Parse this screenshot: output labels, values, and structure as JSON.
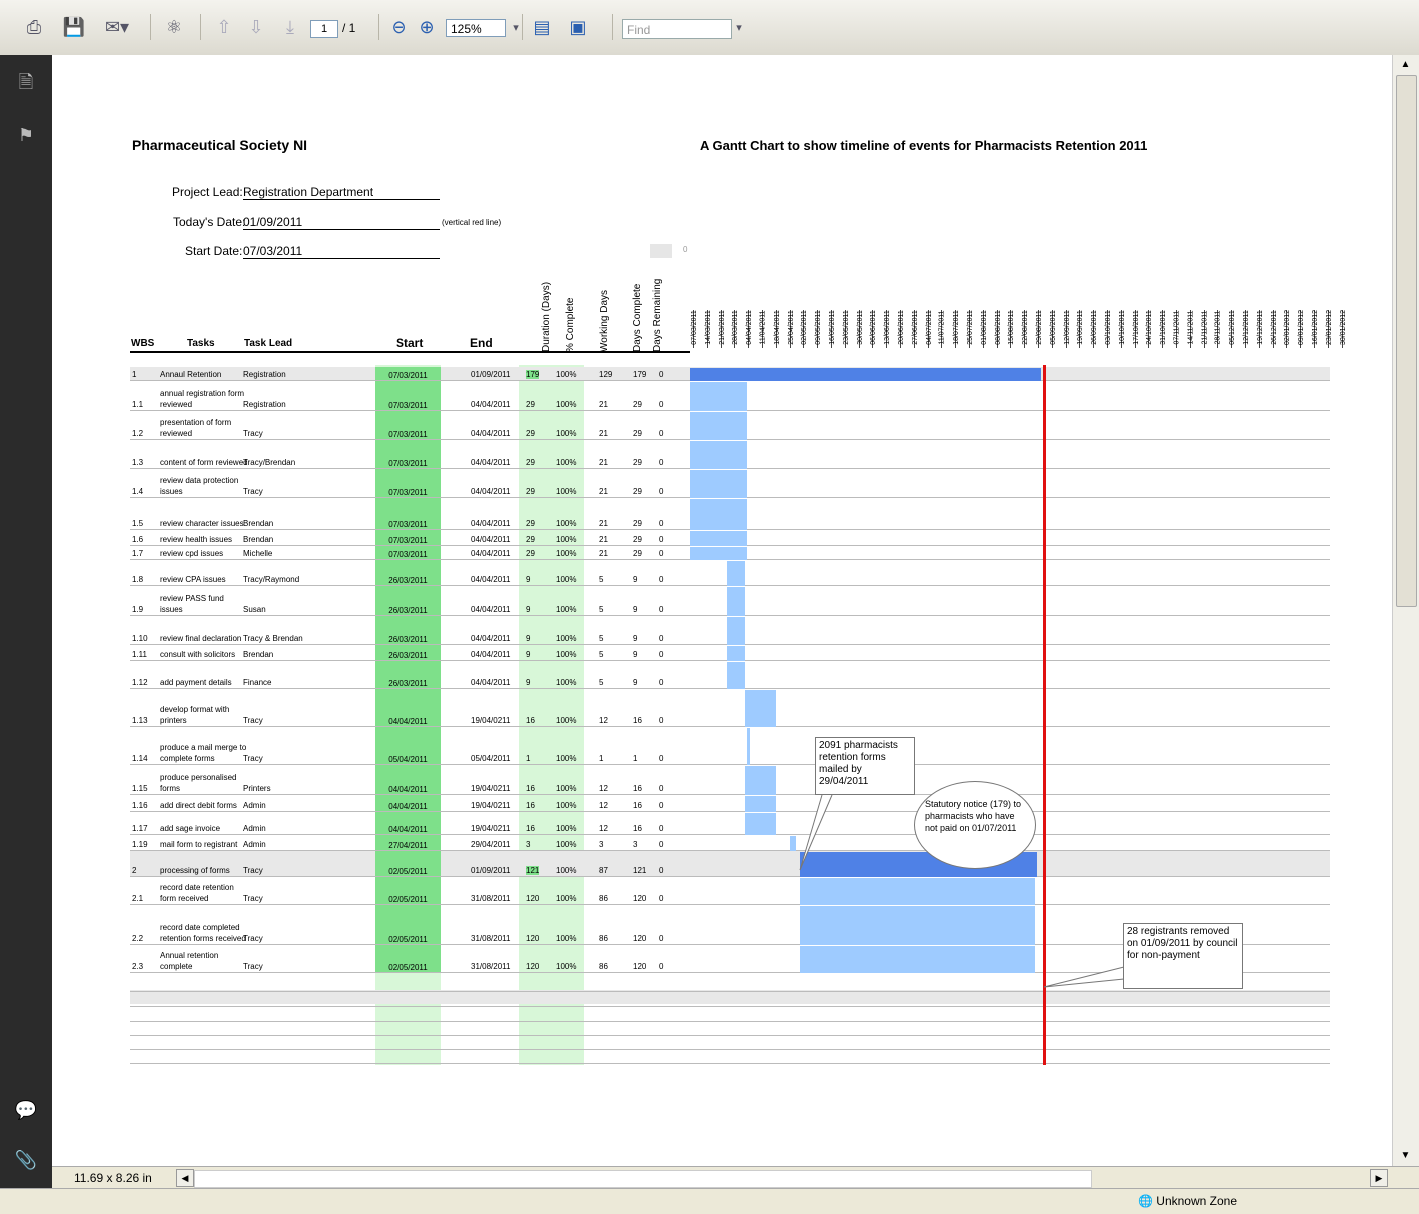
{
  "toolbar": {
    "page_current": "1",
    "page_total": "/ 1",
    "zoom": "125%",
    "find_placeholder": "Find"
  },
  "page_size_label": "11.69 x 8.26 in",
  "status": {
    "zone": "Unknown Zone"
  },
  "doc": {
    "org": "Pharmaceutical Society NI",
    "chart_title": "A Gantt Chart to show timeline of events for Pharmacists Retention 2011",
    "project_lead_label": "Project Lead:",
    "project_lead": "Registration Department",
    "today_label": "Today's Date:",
    "today": "01/09/2011",
    "today_note": "(vertical red line)",
    "start_label": "Start Date:",
    "start": "07/03/2011",
    "zero_mark": "0",
    "headers": {
      "wbs": "WBS",
      "tasks": "Tasks",
      "task_lead": "Task Lead",
      "start": "Start",
      "end": "End",
      "duration": "Duration (Days)",
      "pct": "% Complete",
      "working": "Working Days",
      "days_complete": "Days Complete",
      "days_remaining": "Days Remaining"
    },
    "dates": [
      "07/03/2011",
      "14/03/2011",
      "21/03/2011",
      "28/03/2011",
      "04/04/2011",
      "11/04/2011",
      "18/04/2011",
      "25/04/2011",
      "02/05/2011",
      "09/05/2011",
      "16/05/2011",
      "23/05/2011",
      "30/05/2011",
      "06/06/2011",
      "13/06/2011",
      "20/06/2011",
      "27/06/2011",
      "04/07/2011",
      "11/07/2011",
      "18/07/2011",
      "25/07/2011",
      "01/08/2011",
      "08/08/2011",
      "15/08/2011",
      "22/08/2011",
      "29/08/2011",
      "05/09/2011",
      "12/09/2011",
      "19/09/2011",
      "26/09/2011",
      "03/10/2011",
      "10/10/2011",
      "17/10/2011",
      "24/10/2011",
      "31/10/2011",
      "07/11/2011",
      "14/11/2011",
      "21/11/2011",
      "28/11/2011",
      "05/12/2011",
      "12/12/2011",
      "19/12/2011",
      "26/12/2011",
      "02/01/2012",
      "09/01/2012",
      "16/01/2012",
      "23/01/2012",
      "30/01/2012"
    ],
    "rows": [
      {
        "wbs": "1",
        "task": "Annaul Retention",
        "lead": "Registration",
        "start": "07/03/2011",
        "end": "01/09/2011",
        "dur": "179",
        "pct": "100%",
        "work": "129",
        "done": "179",
        "rem": "0",
        "s": 0,
        "len": 179,
        "summary": true
      },
      {
        "wbs": "1.1",
        "task": "annual registration form|reviewed",
        "lead": "Registration",
        "start": "07/03/2011",
        "end": "04/04/2011",
        "dur": "29",
        "pct": "100%",
        "work": "21",
        "done": "29",
        "rem": "0",
        "s": 0,
        "len": 29
      },
      {
        "wbs": "1.2",
        "task": "presentation of form|reviewed",
        "lead": "Tracy",
        "start": "07/03/2011",
        "end": "04/04/2011",
        "dur": "29",
        "pct": "100%",
        "work": "21",
        "done": "29",
        "rem": "0",
        "s": 0,
        "len": 29
      },
      {
        "wbs": "1.3",
        "task": "content of form reviewed",
        "lead": "Tracy/Brendan",
        "start": "07/03/2011",
        "end": "04/04/2011",
        "dur": "29",
        "pct": "100%",
        "work": "21",
        "done": "29",
        "rem": "0",
        "s": 0,
        "len": 29
      },
      {
        "wbs": "1.4",
        "task": "review data protection|issues",
        "lead": "Tracy",
        "start": "07/03/2011",
        "end": "04/04/2011",
        "dur": "29",
        "pct": "100%",
        "work": "21",
        "done": "29",
        "rem": "0",
        "s": 0,
        "len": 29
      },
      {
        "wbs": "1.5",
        "task": "review character issues",
        "lead": "Brendan",
        "start": "07/03/2011",
        "end": "04/04/2011",
        "dur": "29",
        "pct": "100%",
        "work": "21",
        "done": "29",
        "rem": "0",
        "s": 0,
        "len": 29
      },
      {
        "wbs": "1.6",
        "task": "review health issues",
        "lead": "Brendan",
        "start": "07/03/2011",
        "end": "04/04/2011",
        "dur": "29",
        "pct": "100%",
        "work": "21",
        "done": "29",
        "rem": "0",
        "s": 0,
        "len": 29
      },
      {
        "wbs": "1.7",
        "task": "review cpd issues",
        "lead": "Michelle",
        "start": "07/03/2011",
        "end": "04/04/2011",
        "dur": "29",
        "pct": "100%",
        "work": "21",
        "done": "29",
        "rem": "0",
        "s": 0,
        "len": 29
      },
      {
        "wbs": "1.8",
        "task": "review CPA issues",
        "lead": "Tracy/Raymond",
        "start": "26/03/2011",
        "end": "04/04/2011",
        "dur": "9",
        "pct": "100%",
        "work": "5",
        "done": "9",
        "rem": "0",
        "s": 19,
        "len": 9
      },
      {
        "wbs": "1.9",
        "task": "review PASS fund|issues",
        "lead": "Susan",
        "start": "26/03/2011",
        "end": "04/04/2011",
        "dur": "9",
        "pct": "100%",
        "work": "5",
        "done": "9",
        "rem": "0",
        "s": 19,
        "len": 9
      },
      {
        "wbs": "1.10",
        "task": "review final declaration",
        "lead": "Tracy & Brendan",
        "start": "26/03/2011",
        "end": "04/04/2011",
        "dur": "9",
        "pct": "100%",
        "work": "5",
        "done": "9",
        "rem": "0",
        "s": 19,
        "len": 9
      },
      {
        "wbs": "1.11",
        "task": "consult with solicitors",
        "lead": "Brendan",
        "start": "26/03/2011",
        "end": "04/04/2011",
        "dur": "9",
        "pct": "100%",
        "work": "5",
        "done": "9",
        "rem": "0",
        "s": 19,
        "len": 9
      },
      {
        "wbs": "1.12",
        "task": "add payment details",
        "lead": "Finance",
        "start": "26/03/2011",
        "end": "04/04/2011",
        "dur": "9",
        "pct": "100%",
        "work": "5",
        "done": "9",
        "rem": "0",
        "s": 19,
        "len": 9
      },
      {
        "wbs": "1.13",
        "task": "develop format with|printers",
        "lead": "Tracy",
        "start": "04/04/2011",
        "end": "19/04/0211",
        "dur": "16",
        "pct": "100%",
        "work": "12",
        "done": "16",
        "rem": "0",
        "s": 28,
        "len": 16
      },
      {
        "wbs": "1.14",
        "task": "produce a mail merge to|complete forms",
        "lead": "Tracy",
        "start": "05/04/2011",
        "end": "05/04/2011",
        "dur": "1",
        "pct": "100%",
        "work": "1",
        "done": "1",
        "rem": "0",
        "s": 29,
        "len": 1
      },
      {
        "wbs": "1.15",
        "task": "produce personalised|forms",
        "lead": "Printers",
        "start": "04/04/2011",
        "end": "19/04/0211",
        "dur": "16",
        "pct": "100%",
        "work": "12",
        "done": "16",
        "rem": "0",
        "s": 28,
        "len": 16
      },
      {
        "wbs": "1.16",
        "task": "add direct debit forms",
        "lead": "Admin",
        "start": "04/04/2011",
        "end": "19/04/0211",
        "dur": "16",
        "pct": "100%",
        "work": "12",
        "done": "16",
        "rem": "0",
        "s": 28,
        "len": 16
      },
      {
        "wbs": "1.17",
        "task": "add sage invoice",
        "lead": "Admin",
        "start": "04/04/2011",
        "end": "19/04/0211",
        "dur": "16",
        "pct": "100%",
        "work": "12",
        "done": "16",
        "rem": "0",
        "s": 28,
        "len": 16
      },
      {
        "wbs": "1.19",
        "task": "mail form to registrant",
        "lead": "Admin",
        "start": "27/04/2011",
        "end": "29/04/2011",
        "dur": "3",
        "pct": "100%",
        "work": "3",
        "done": "3",
        "rem": "0",
        "s": 51,
        "len": 3
      },
      {
        "wbs": "2",
        "task": "processing of forms",
        "lead": "Tracy",
        "start": "02/05/2011",
        "end": "01/09/2011",
        "dur": "121",
        "pct": "100%",
        "work": "87",
        "done": "121",
        "rem": "0",
        "s": 56,
        "len": 121,
        "summary": true
      },
      {
        "wbs": "2.1",
        "task": "record date retention|form received",
        "lead": "Tracy",
        "start": "02/05/2011",
        "end": "31/08/2011",
        "dur": "120",
        "pct": "100%",
        "work": "86",
        "done": "120",
        "rem": "0",
        "s": 56,
        "len": 120
      },
      {
        "wbs": "2.2",
        "task": "record date completed|retention forms received",
        "lead": "Tracy",
        "start": "02/05/2011",
        "end": "31/08/2011",
        "dur": "120",
        "pct": "100%",
        "work": "86",
        "done": "120",
        "rem": "0",
        "s": 56,
        "len": 120
      },
      {
        "wbs": "2.3",
        "task": "Annual retention|complete",
        "lead": "Tracy",
        "start": "02/05/2011",
        "end": "31/08/2011",
        "dur": "120",
        "pct": "100%",
        "work": "86",
        "done": "120",
        "rem": "0",
        "s": 56,
        "len": 120
      }
    ],
    "callouts": {
      "mailed": "2091 pharmacists retention forms mailed by 29/04/2011",
      "notice": "Statutory notice (179) to pharmacists who have not paid on 01/07/2011",
      "removed": "28 registrants removed on 01/09/2011 by council for non-payment"
    },
    "colors": {
      "summary_bar": "#4f81e6",
      "task_bar": "#9ecbff",
      "today_line": "#e01010",
      "start_green": "#7ee08a",
      "light_green": "#d8f7d8"
    }
  }
}
